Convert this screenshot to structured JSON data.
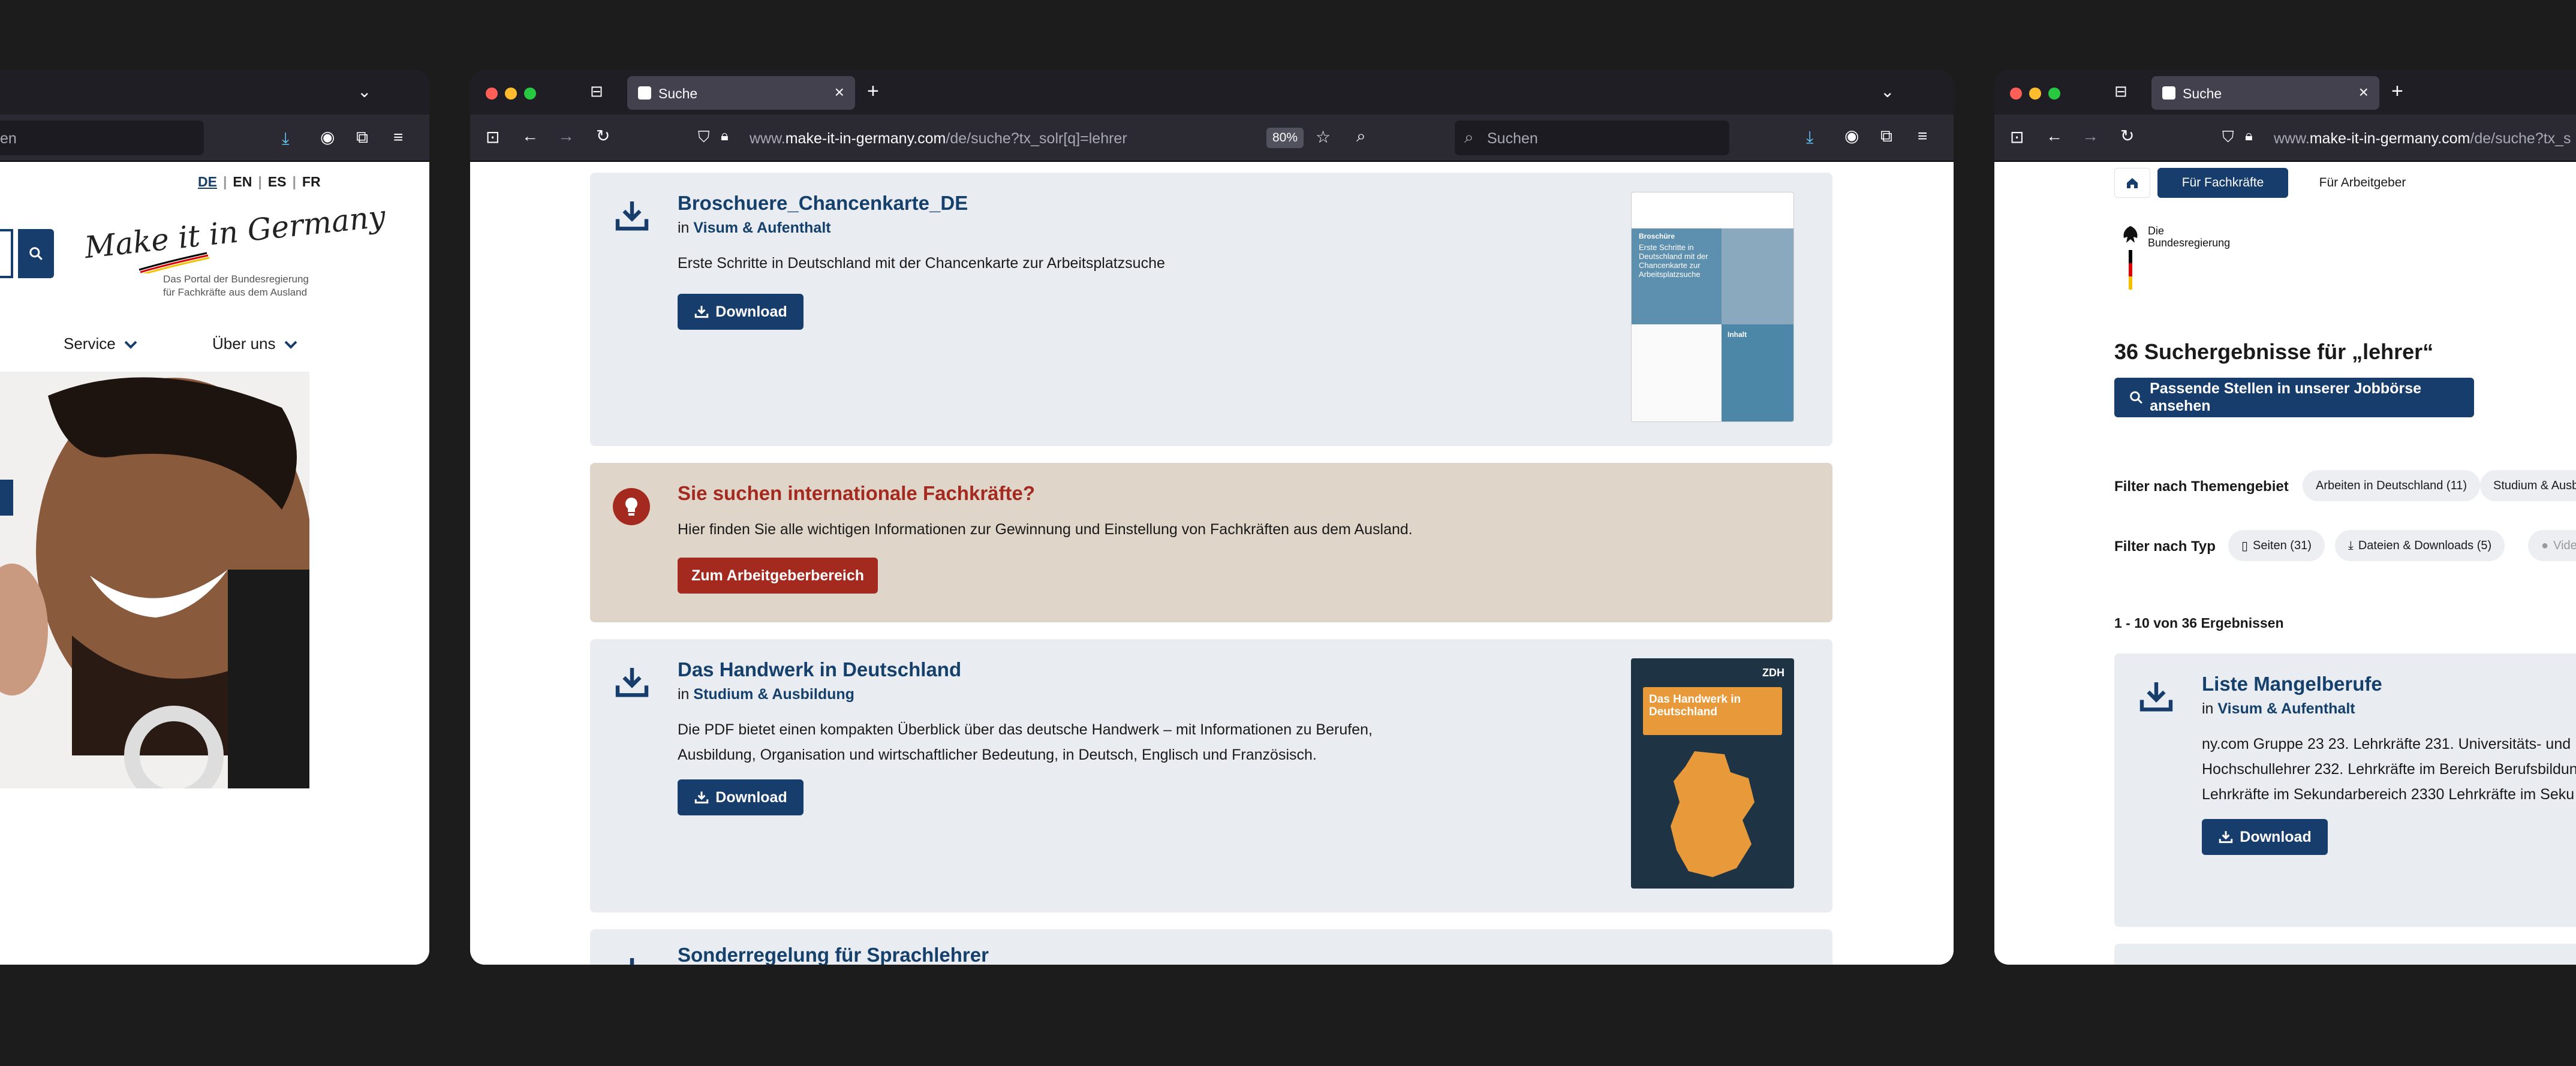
{
  "left_window": {
    "languages": [
      "DE",
      "EN",
      "ES",
      "FR"
    ],
    "search_hint": "en",
    "logo_script": "Make it in Germany",
    "logo_tagline_1": "Das Portal der Bundesregierung",
    "logo_tagline_2": "für Fachkräfte aus dem Ausland",
    "nav": {
      "service": "Service",
      "about": "Über uns"
    }
  },
  "center_window": {
    "tab_title": "Suche",
    "url": {
      "prefix": "www.",
      "domain": "make-it-in-germany.com",
      "path": "/de/suche?tx_solr[q]=lehrer"
    },
    "zoom": "80%",
    "search_placeholder": "Suchen",
    "results": [
      {
        "title": "Broschuere_Chancenkarte_DE",
        "in_label": "in",
        "category": "Visum & Aufenthalt",
        "description": "Erste Schritte in Deutschland mit der Chancenkarte zur Arbeitsplatzsuche",
        "button": "Download"
      },
      {
        "title": "Das Handwerk in Deutschland",
        "in_label": "in",
        "category": "Studium & Ausbildung",
        "description_1": "Die PDF bietet einen kompakten Überblick über das deutsche Handwerk – mit Informationen zu Berufen,",
        "description_2": "Ausbildung, Organisation und wirtschaftlicher Bedeutung, in Deutsch, Englisch und Französisch.",
        "button": "Download"
      },
      {
        "title": "Sonderregelung für Sprachlehrer"
      }
    ],
    "promo": {
      "title": "Sie suchen internationale Fachkräfte?",
      "text": "Hier finden Sie alle wichtigen Informationen zur Gewinnung und Einstellung von Fachkräften aus dem Ausland.",
      "button": "Zum Arbeitgeberbereich"
    },
    "cover1": {
      "label": "Broschüre",
      "title": "Erste Schritte in Deutschland mit der Chancenkarte zur Arbeitsplatzsuche",
      "inhalt": "Inhalt"
    },
    "cover2": {
      "badge": "ZDH",
      "title": "Das Handwerk in Deutschland"
    }
  },
  "right_window": {
    "tab_title": "Suche",
    "url": {
      "prefix": "www.",
      "domain": "make-it-in-germany.com",
      "path": "/de/suche?tx_s"
    },
    "tabs": {
      "skilled": "Für Fachkräfte",
      "employer": "Für Arbeitgeber"
    },
    "gov_logo": {
      "line1": "Die",
      "line2": "Bundesregierung"
    },
    "heading": "36 Suchergebnisse für „lehrer“",
    "jobboard_button": "Passende Stellen in unserer Jobbörse ansehen",
    "filter_topic_label": "Filter nach Themengebiet",
    "filter_topic_chips": [
      "Arbeiten in Deutschland (11)",
      "Studium & Ausb"
    ],
    "filter_type_label": "Filter nach Typ",
    "filter_type_chips": [
      "Seiten (31)",
      "Dateien & Downloads (5)",
      "Vide"
    ],
    "count": "1 - 10 von 36 Ergebnissen",
    "result": {
      "title": "Liste Mangelberufe",
      "in_label": "in",
      "category": "Visum & Aufenthalt",
      "line1": "ny.com Gruppe 23 23. Lehrkräfte 231. Universitäts- und",
      "line2": "Hochschullehrer 232. Lehrkräfte im Bereich Berufsbildun",
      "line3": "Lehrkräfte im Sekundarbereich 2330 Lehrkräfte im Seku",
      "button": "Download"
    }
  },
  "colors": {
    "navy": "#163d6b",
    "promo_red": "#a42a20",
    "card_bg": "#e9ecf0",
    "promo_bg": "#dfd5c8"
  }
}
